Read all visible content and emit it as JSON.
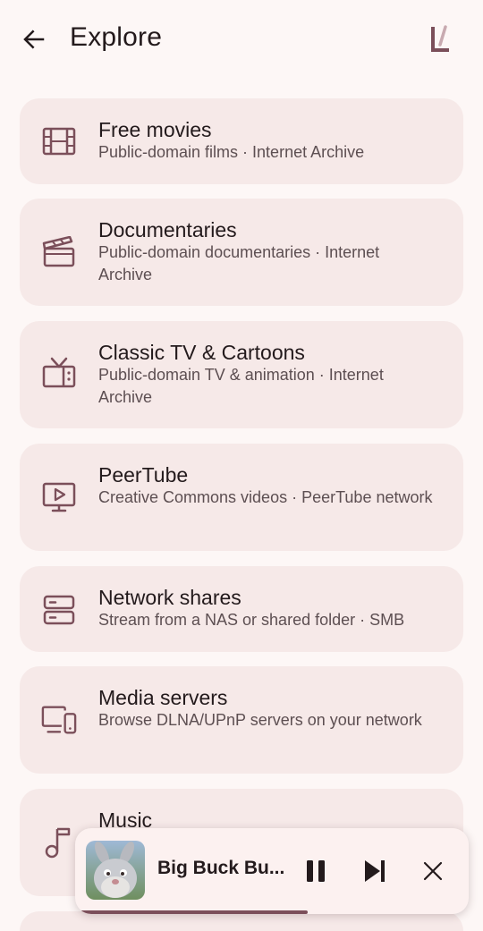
{
  "header": {
    "title": "Explore",
    "back_icon": "arrow-left-icon",
    "logo_icon": "app-logo-icon"
  },
  "colors": {
    "background": "#fdf7f6",
    "card": "#f6e9e8",
    "accent": "#7b4f5a",
    "text_primary": "#231a1c",
    "text_secondary": "#5d4f52"
  },
  "sources": [
    {
      "title": "Free movies",
      "subtitle": "Public-domain films · Internet Archive",
      "icon": "film-strip-icon"
    },
    {
      "title": "Documentaries",
      "subtitle": "Public-domain documentaries · Internet Archive",
      "icon": "clapperboard-icon"
    },
    {
      "title": "Classic TV & Cartoons",
      "subtitle": "Public-domain TV & animation · Internet Archive",
      "icon": "retro-tv-icon"
    },
    {
      "title": "PeerTube",
      "subtitle": "Creative Commons videos · PeerTube network",
      "icon": "play-monitor-icon"
    },
    {
      "title": "Network shares",
      "subtitle": "Stream from a NAS or shared folder · SMB",
      "icon": "server-icon"
    },
    {
      "title": "Media servers",
      "subtitle": "Browse DLNA/UPnP servers on your network",
      "icon": "devices-icon"
    },
    {
      "title": "Music",
      "subtitle": "",
      "icon": "music-note-icon"
    }
  ],
  "mini_player": {
    "title": "Big Buck Bu...",
    "progress": 0.59,
    "pause_icon": "pause-icon",
    "next_icon": "skip-next-icon",
    "close_icon": "close-icon"
  }
}
